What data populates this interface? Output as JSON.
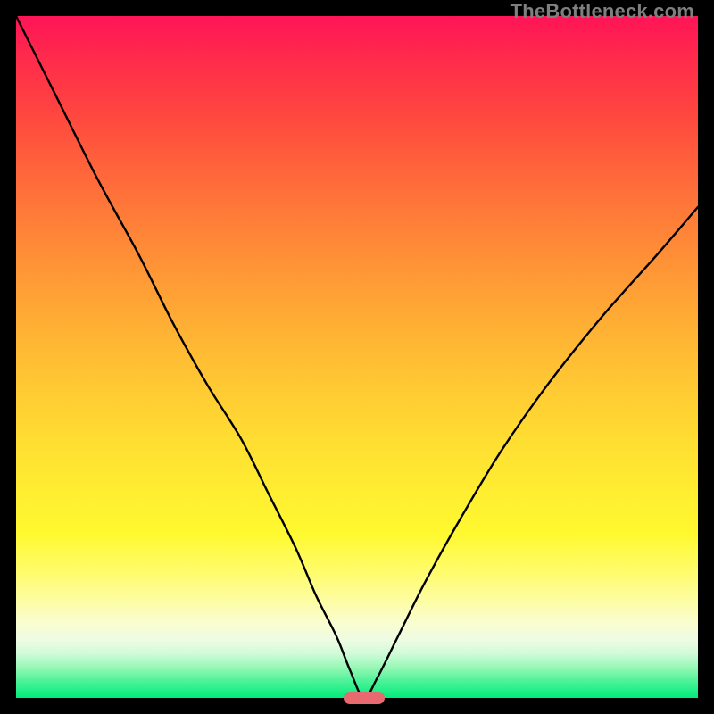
{
  "watermark": "TheBottleneck.com",
  "colors": {
    "curve": "#000000",
    "marker": "#e66a6f",
    "frame": "#000000"
  },
  "chart_data": {
    "type": "line",
    "title": "",
    "xlabel": "",
    "ylabel": "",
    "xlim": [
      0,
      100
    ],
    "ylim": [
      0,
      100
    ],
    "grid": false,
    "legend": false,
    "marker": {
      "x": 51,
      "y": 0,
      "width_pct": 6
    },
    "series": [
      {
        "name": "bottleneck-curve",
        "x": [
          0,
          6,
          12,
          18,
          23,
          28,
          33,
          37,
          41,
          44,
          47,
          49,
          51,
          53,
          56,
          60,
          65,
          71,
          78,
          86,
          94,
          100
        ],
        "y": [
          100,
          88,
          76,
          65,
          55,
          46,
          38,
          30,
          22,
          15,
          9,
          4,
          0,
          3,
          9,
          17,
          26,
          36,
          46,
          56,
          65,
          72
        ]
      }
    ],
    "background_gradient_stops": [
      {
        "pos": 0.0,
        "color": "#ff1457"
      },
      {
        "pos": 0.14,
        "color": "#ff4540"
      },
      {
        "pos": 0.3,
        "color": "#ff7e38"
      },
      {
        "pos": 0.46,
        "color": "#ffb134"
      },
      {
        "pos": 0.62,
        "color": "#ffdd32"
      },
      {
        "pos": 0.76,
        "color": "#fff930"
      },
      {
        "pos": 0.88,
        "color": "#fafdd0"
      },
      {
        "pos": 0.94,
        "color": "#98f8b6"
      },
      {
        "pos": 1.0,
        "color": "#00ec7b"
      }
    ]
  }
}
